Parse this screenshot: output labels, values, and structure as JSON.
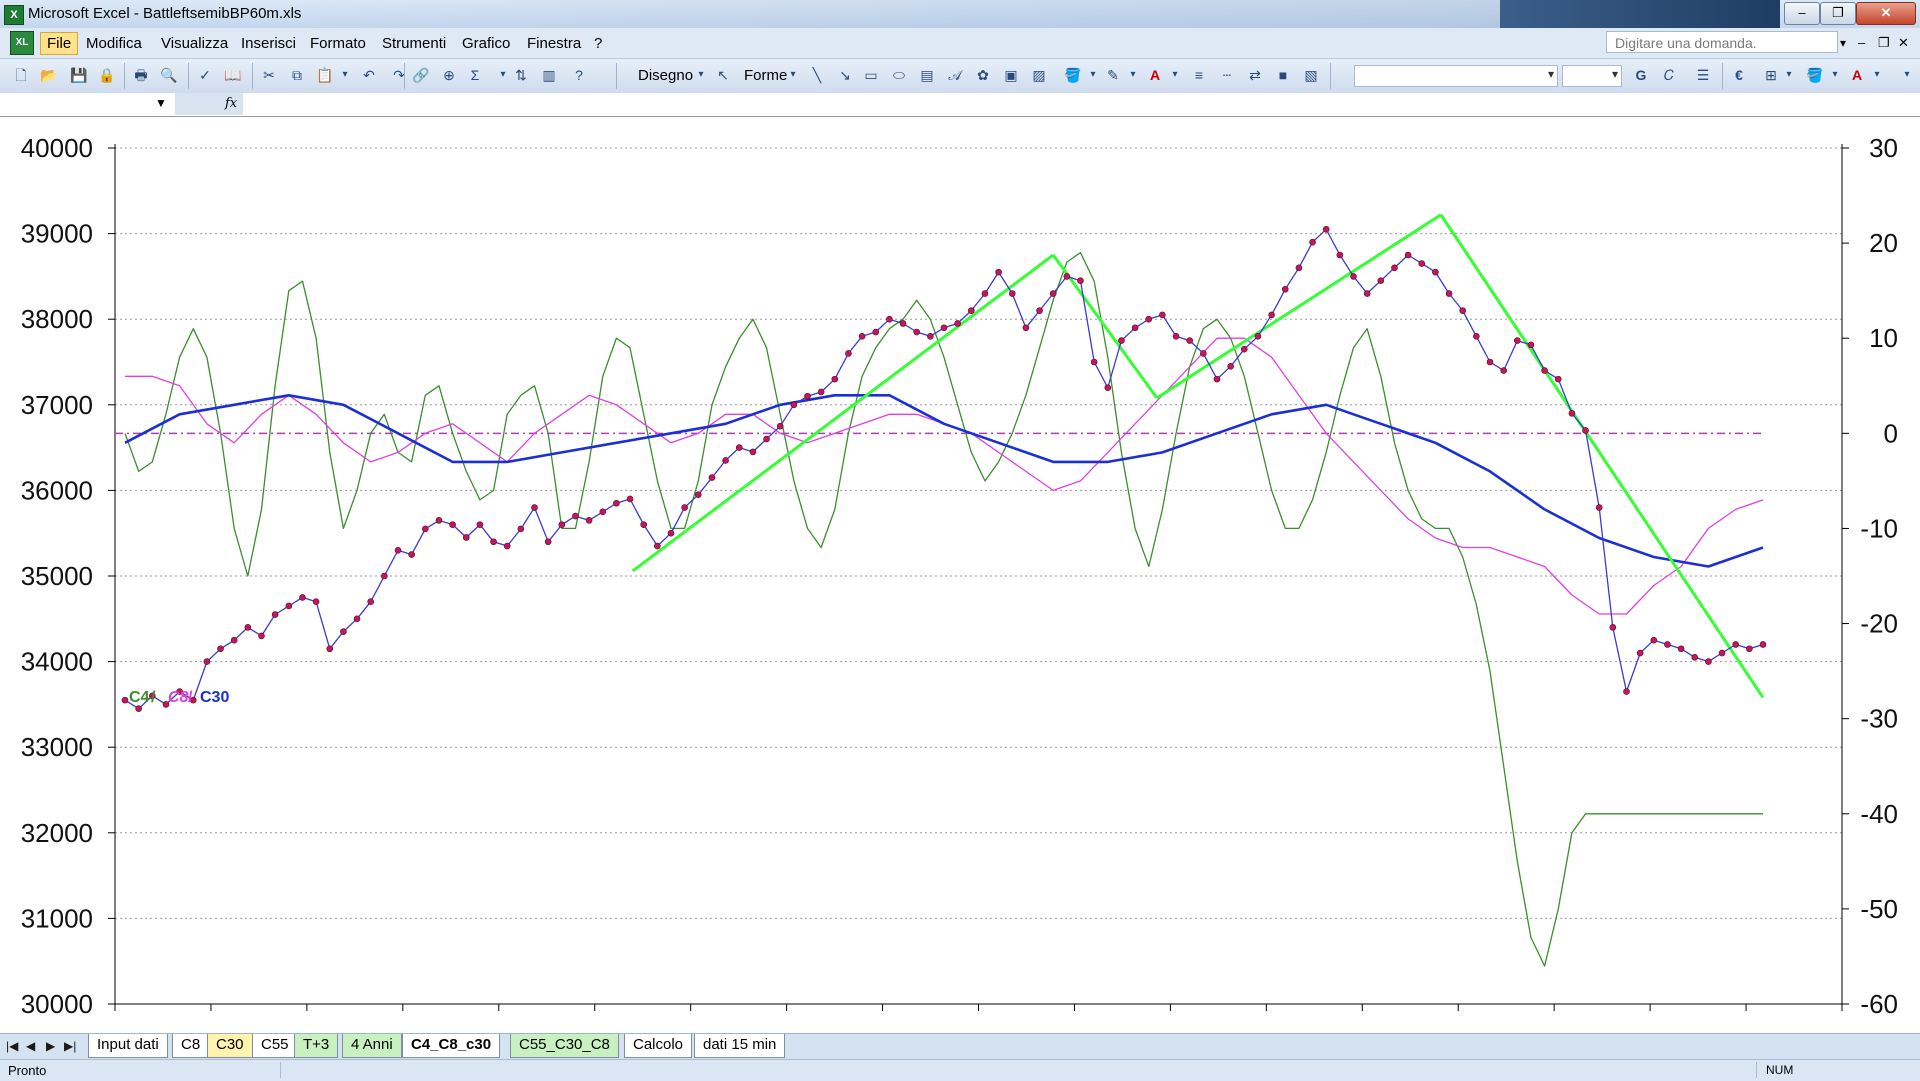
{
  "window": {
    "title": "Microsoft Excel - BattleftsemibBP60m.xls",
    "app_icon": "excel-icon",
    "controls": {
      "minimize": "‒",
      "restore": "❐",
      "close": "✕"
    }
  },
  "menubar": {
    "items": [
      "File",
      "Modifica",
      "Visualizza",
      "Inserisci",
      "Formato",
      "Strumenti",
      "Grafico",
      "Finestra",
      "?"
    ],
    "help_box_placeholder": "Digitare una domanda.",
    "mdi_controls": [
      "‒",
      "❐",
      "✕"
    ]
  },
  "toolbar": {
    "draw_label": "Disegno",
    "shapes_label": "Forme",
    "bold_label": "G",
    "currency_label": "€",
    "font_color_label": "A",
    "sigma_label": "Σ"
  },
  "formula_bar": {
    "fx_label": "fx"
  },
  "chart": {
    "legend_text": {
      "c4": "C4",
      "sep1": "/",
      "c8": "C8",
      "sep2": "/",
      "c30": "C30"
    },
    "colors": {
      "price_line": "#3b3bd4",
      "price_marker": "#c2185b",
      "c4": "#3a8f2c",
      "c8": "#e040e0",
      "c30": "#1a2fd6",
      "trend": "#33ff33",
      "zero_line": "#b03cb0"
    },
    "chart_data": {
      "type": "line",
      "title": "",
      "left_axis": {
        "min": 30000,
        "max": 40000,
        "ticks": [
          "30000",
          "31000",
          "32000",
          "33000",
          "34000",
          "35000",
          "36000",
          "37000",
          "38000",
          "39000",
          "40000"
        ]
      },
      "right_axis": {
        "min": -60,
        "max": 30,
        "ticks": [
          "-60",
          "-50",
          "-40",
          "-30",
          "-20",
          "-10",
          "0",
          "10",
          "20",
          "30"
        ]
      },
      "grid": "horizontal-dotted",
      "series": [
        {
          "name": "",
          "axis": "left",
          "role": "price",
          "x": [
            0,
            5,
            10,
            15,
            20,
            25,
            30,
            35,
            40,
            45,
            50,
            55,
            60,
            65,
            70,
            75,
            80,
            85,
            90,
            95,
            100,
            105,
            110,
            115,
            120,
            125,
            130,
            135,
            140,
            145,
            150,
            155,
            160,
            165,
            170,
            175,
            180,
            185,
            190,
            195,
            200,
            205,
            210,
            215,
            220,
            225,
            230,
            235,
            240,
            245,
            250,
            255,
            260,
            265,
            270,
            275,
            280,
            285,
            290,
            295,
            300,
            305,
            310,
            315,
            320,
            325,
            330,
            335,
            340,
            345,
            350,
            355,
            360,
            365,
            370,
            375,
            380,
            385,
            390,
            395,
            400,
            405,
            410,
            415,
            420,
            425,
            430,
            435,
            440,
            445,
            450,
            455,
            460,
            465,
            470,
            475,
            480,
            485,
            490,
            495,
            500,
            505,
            510,
            515,
            520,
            525,
            530,
            535,
            540,
            545,
            550,
            555,
            560,
            565,
            570,
            575,
            580,
            585,
            590,
            595,
            600
          ],
          "y": [
            33550,
            33450,
            33600,
            33500,
            33650,
            33550,
            34000,
            34150,
            34250,
            34400,
            34300,
            34550,
            34650,
            34750,
            34700,
            34150,
            34350,
            34500,
            34700,
            35000,
            35300,
            35250,
            35550,
            35650,
            35600,
            35450,
            35600,
            35400,
            35350,
            35550,
            35800,
            35400,
            35600,
            35700,
            35650,
            35750,
            35850,
            35900,
            35600,
            35350,
            35500,
            35800,
            35950,
            36150,
            36350,
            36500,
            36450,
            36600,
            36750,
            37000,
            37100,
            37150,
            37300,
            37600,
            37800,
            37850,
            38000,
            37950,
            37850,
            37800,
            37900,
            37950,
            38100,
            38300,
            38550,
            38300,
            37900,
            38100,
            38300,
            38500,
            38450,
            37500,
            37200,
            37750,
            37900,
            38000,
            38050,
            37800,
            37750,
            37600,
            37300,
            37450,
            37650,
            37800,
            38050,
            38350,
            38600,
            38900,
            39050,
            38750,
            38500,
            38300,
            38450,
            38600,
            38750,
            38650,
            38550,
            38300,
            38100,
            37800,
            37500,
            37400,
            37750,
            37700,
            37400,
            37300,
            36900,
            36700,
            35800,
            34400,
            33650,
            34100,
            34250,
            34200,
            34150,
            34050,
            34000,
            34100,
            34200,
            34150,
            34200
          ]
        },
        {
          "name": "C4",
          "axis": "right",
          "role": "oscillator-fast",
          "x": [
            0,
            5,
            10,
            15,
            20,
            25,
            30,
            35,
            40,
            45,
            50,
            55,
            60,
            65,
            70,
            75,
            80,
            85,
            90,
            95,
            100,
            105,
            110,
            115,
            120,
            125,
            130,
            135,
            140,
            145,
            150,
            155,
            160,
            165,
            170,
            175,
            180,
            185,
            190,
            195,
            200,
            205,
            210,
            215,
            220,
            225,
            230,
            235,
            240,
            245,
            250,
            255,
            260,
            265,
            270,
            275,
            280,
            285,
            290,
            295,
            300,
            305,
            310,
            315,
            320,
            325,
            330,
            335,
            340,
            345,
            350,
            355,
            360,
            365,
            370,
            375,
            380,
            385,
            390,
            395,
            400,
            405,
            410,
            415,
            420,
            425,
            430,
            435,
            440,
            445,
            450,
            455,
            460,
            465,
            470,
            475,
            480,
            485,
            490,
            495,
            500,
            505,
            510,
            515,
            520,
            525,
            530,
            535,
            540,
            545,
            550,
            555,
            560,
            565,
            570,
            575,
            580,
            585,
            590,
            595,
            600
          ],
          "y": [
            0,
            -4,
            -3,
            2,
            8,
            11,
            8,
            0,
            -10,
            -15,
            -8,
            5,
            15,
            16,
            10,
            -2,
            -10,
            -6,
            0,
            2,
            -2,
            -3,
            4,
            5,
            0,
            -4,
            -7,
            -6,
            2,
            4,
            5,
            0,
            -10,
            -10,
            -3,
            6,
            10,
            9,
            2,
            -5,
            -10,
            -10,
            -5,
            3,
            7,
            10,
            12,
            9,
            2,
            -5,
            -10,
            -12,
            -8,
            0,
            6,
            9,
            11,
            12,
            14,
            12,
            8,
            3,
            -2,
            -5,
            -3,
            0,
            4,
            9,
            14,
            18,
            19,
            16,
            8,
            -2,
            -10,
            -14,
            -8,
            0,
            7,
            11,
            12,
            10,
            6,
            0,
            -6,
            -10,
            -10,
            -7,
            -2,
            4,
            9,
            11,
            6,
            -1,
            -6,
            -9,
            -10,
            -10,
            -13,
            -18,
            -25,
            -35,
            -45,
            -53,
            -56,
            -50,
            -42,
            -40,
            -40,
            -40,
            -40,
            -40,
            -40,
            -40,
            -40,
            -40,
            -40,
            -40,
            -40,
            -40,
            -40
          ]
        },
        {
          "name": "C8",
          "axis": "right",
          "role": "oscillator-mid",
          "x": [
            0,
            10,
            20,
            30,
            40,
            50,
            60,
            70,
            80,
            90,
            100,
            110,
            120,
            130,
            140,
            150,
            160,
            170,
            180,
            190,
            200,
            210,
            220,
            230,
            240,
            250,
            260,
            270,
            280,
            290,
            300,
            310,
            320,
            330,
            340,
            350,
            360,
            370,
            380,
            390,
            400,
            410,
            420,
            430,
            440,
            450,
            460,
            470,
            480,
            490,
            500,
            510,
            520,
            530,
            540,
            550,
            560,
            570,
            580,
            590,
            600
          ],
          "y": [
            6,
            6,
            5,
            1,
            -1,
            2,
            4,
            2,
            -1,
            -3,
            -2,
            0,
            1,
            -1,
            -3,
            0,
            2,
            4,
            3,
            1,
            -1,
            0,
            2,
            2,
            0,
            -1,
            0,
            1,
            2,
            2,
            1,
            0,
            -2,
            -4,
            -6,
            -5,
            -2,
            1,
            4,
            7,
            10,
            10,
            8,
            4,
            0,
            -3,
            -6,
            -9,
            -11,
            -12,
            -12,
            -13,
            -14,
            -17,
            -19,
            -19,
            -16,
            -14,
            -10,
            -8,
            -7
          ]
        },
        {
          "name": "C30",
          "axis": "right",
          "role": "oscillator-slow",
          "x": [
            0,
            20,
            40,
            60,
            80,
            100,
            120,
            140,
            160,
            180,
            200,
            220,
            240,
            260,
            280,
            300,
            320,
            340,
            360,
            380,
            400,
            420,
            440,
            460,
            480,
            500,
            520,
            540,
            560,
            580,
            600
          ],
          "y": [
            -1,
            2,
            3,
            4,
            3,
            0,
            -3,
            -3,
            -2,
            -1,
            0,
            1,
            3,
            4,
            4,
            1,
            -1,
            -3,
            -3,
            -2,
            0,
            2,
            3,
            1,
            -1,
            -4,
            -8,
            -11,
            -13,
            -14,
            -12
          ]
        },
        {
          "name": "",
          "axis": "left",
          "role": "trendlines",
          "segments": [
            [
              [
                186,
                35060
              ],
              [
                340,
                38750
              ]
            ],
            [
              [
                340,
                38750
              ],
              [
                378,
                37080
              ]
            ],
            [
              [
                378,
                37080
              ],
              [
                482,
                39220
              ]
            ],
            [
              [
                482,
                39220
              ],
              [
                600,
                33580
              ]
            ]
          ]
        }
      ]
    }
  },
  "sheet_tabs": {
    "nav": [
      "|◀",
      "◀",
      "▶",
      "▶|"
    ],
    "tabs": [
      "Input dati",
      "C8",
      "C30",
      "C55",
      "T+3",
      "4 Anni",
      "C4_C8_c30",
      "C55_C30_C8",
      "Calcolo",
      "dati 15 min"
    ],
    "active": "C4_C8_c30"
  },
  "status": {
    "ready": "Pronto",
    "num": "NUM"
  }
}
